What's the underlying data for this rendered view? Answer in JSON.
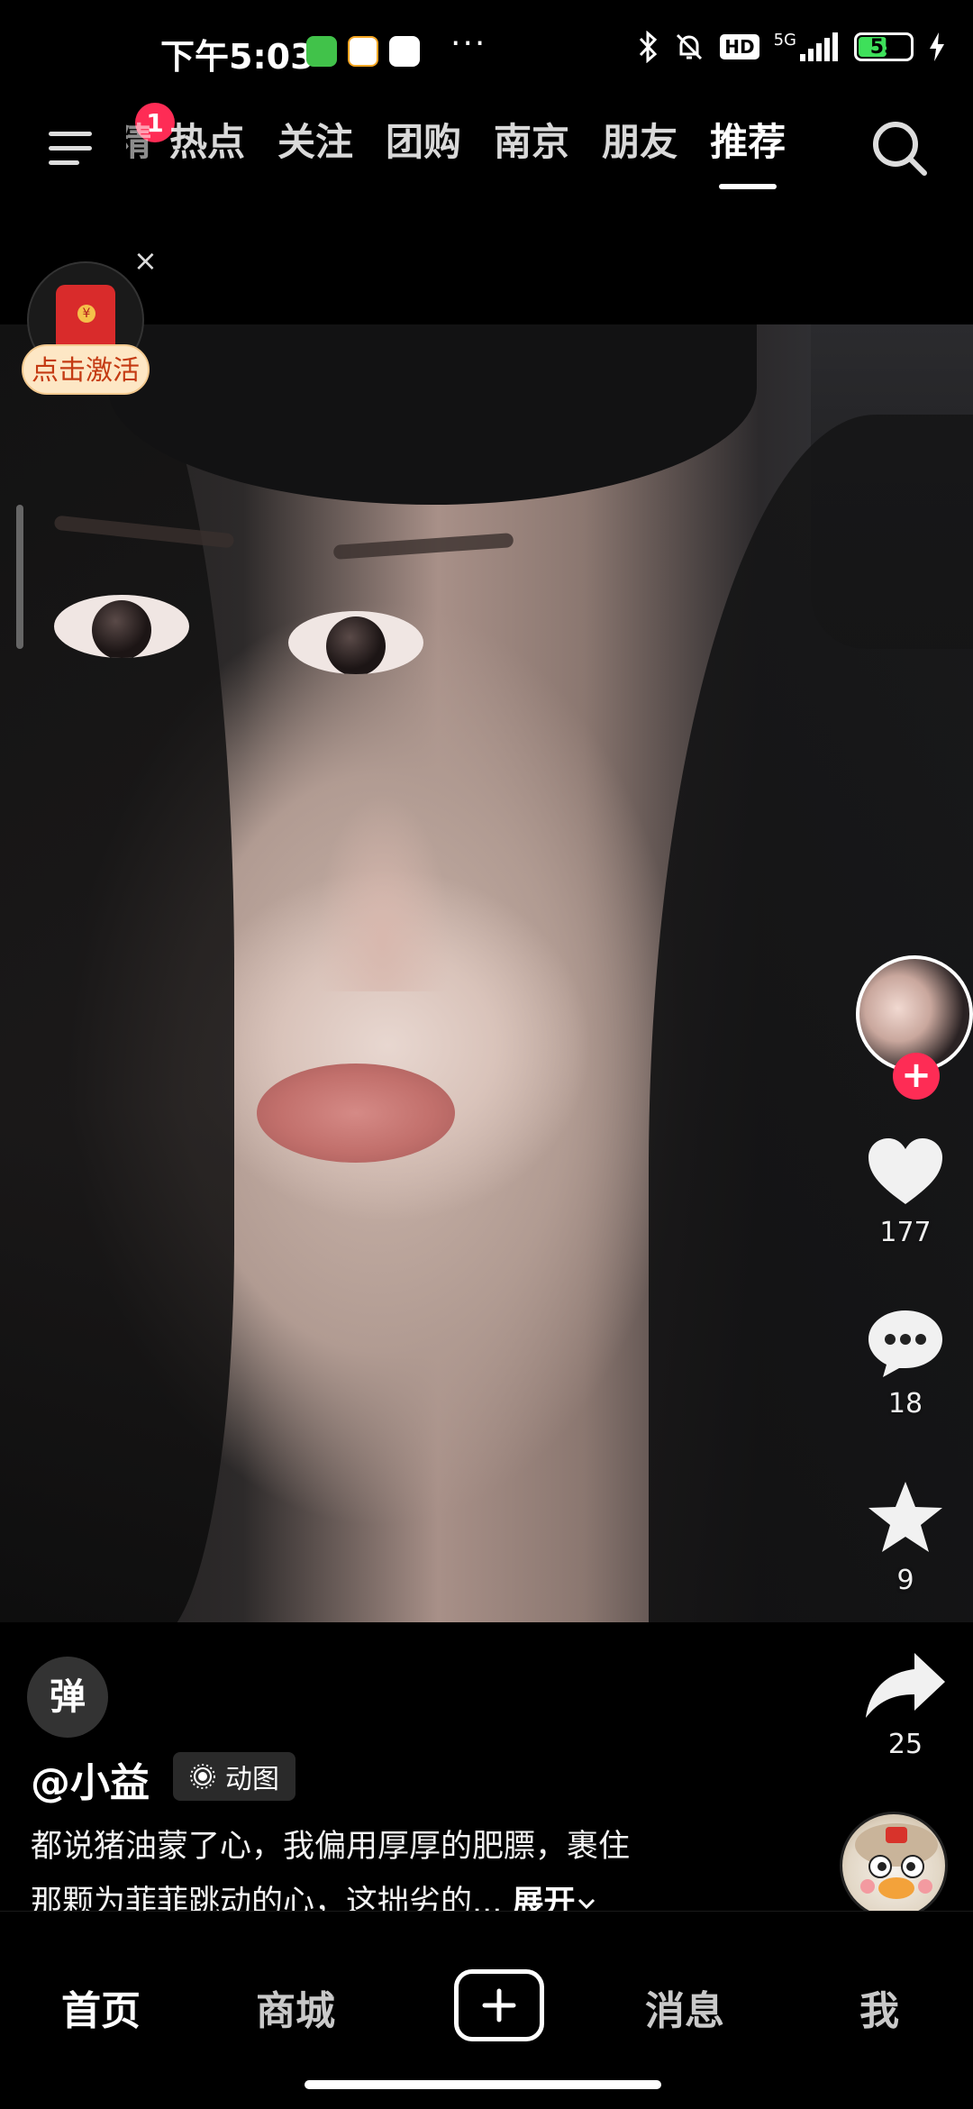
{
  "status_bar": {
    "time": "下午5:03",
    "network": "5G",
    "hd": "HD",
    "battery": "55",
    "more": "···"
  },
  "top_nav": {
    "menu_badge": "1",
    "tabs": [
      "热点",
      "关注",
      "团购",
      "南京",
      "朋友",
      "推荐"
    ],
    "partial_tab": "精选",
    "active_tab": "推荐"
  },
  "red_packet": {
    "label": "点击激活",
    "close": "×"
  },
  "rail": {
    "likes": "177",
    "comments": "18",
    "favorites": "9",
    "shares": "25",
    "follow_plus": "+"
  },
  "post": {
    "danmu": "弹",
    "username": "@小益",
    "tag": "动图",
    "caption_line1": "都说猪油蒙了心，我偏用厚厚的肥膘，裹住",
    "caption_line2": "那颗为菲菲跳动的心，这拙劣的...",
    "expand": "展开"
  },
  "tabbar": {
    "home": "首页",
    "mall": "商城",
    "messages": "消息",
    "me": "我"
  },
  "colors": {
    "accent": "#fe2c55",
    "background": "#000000"
  }
}
